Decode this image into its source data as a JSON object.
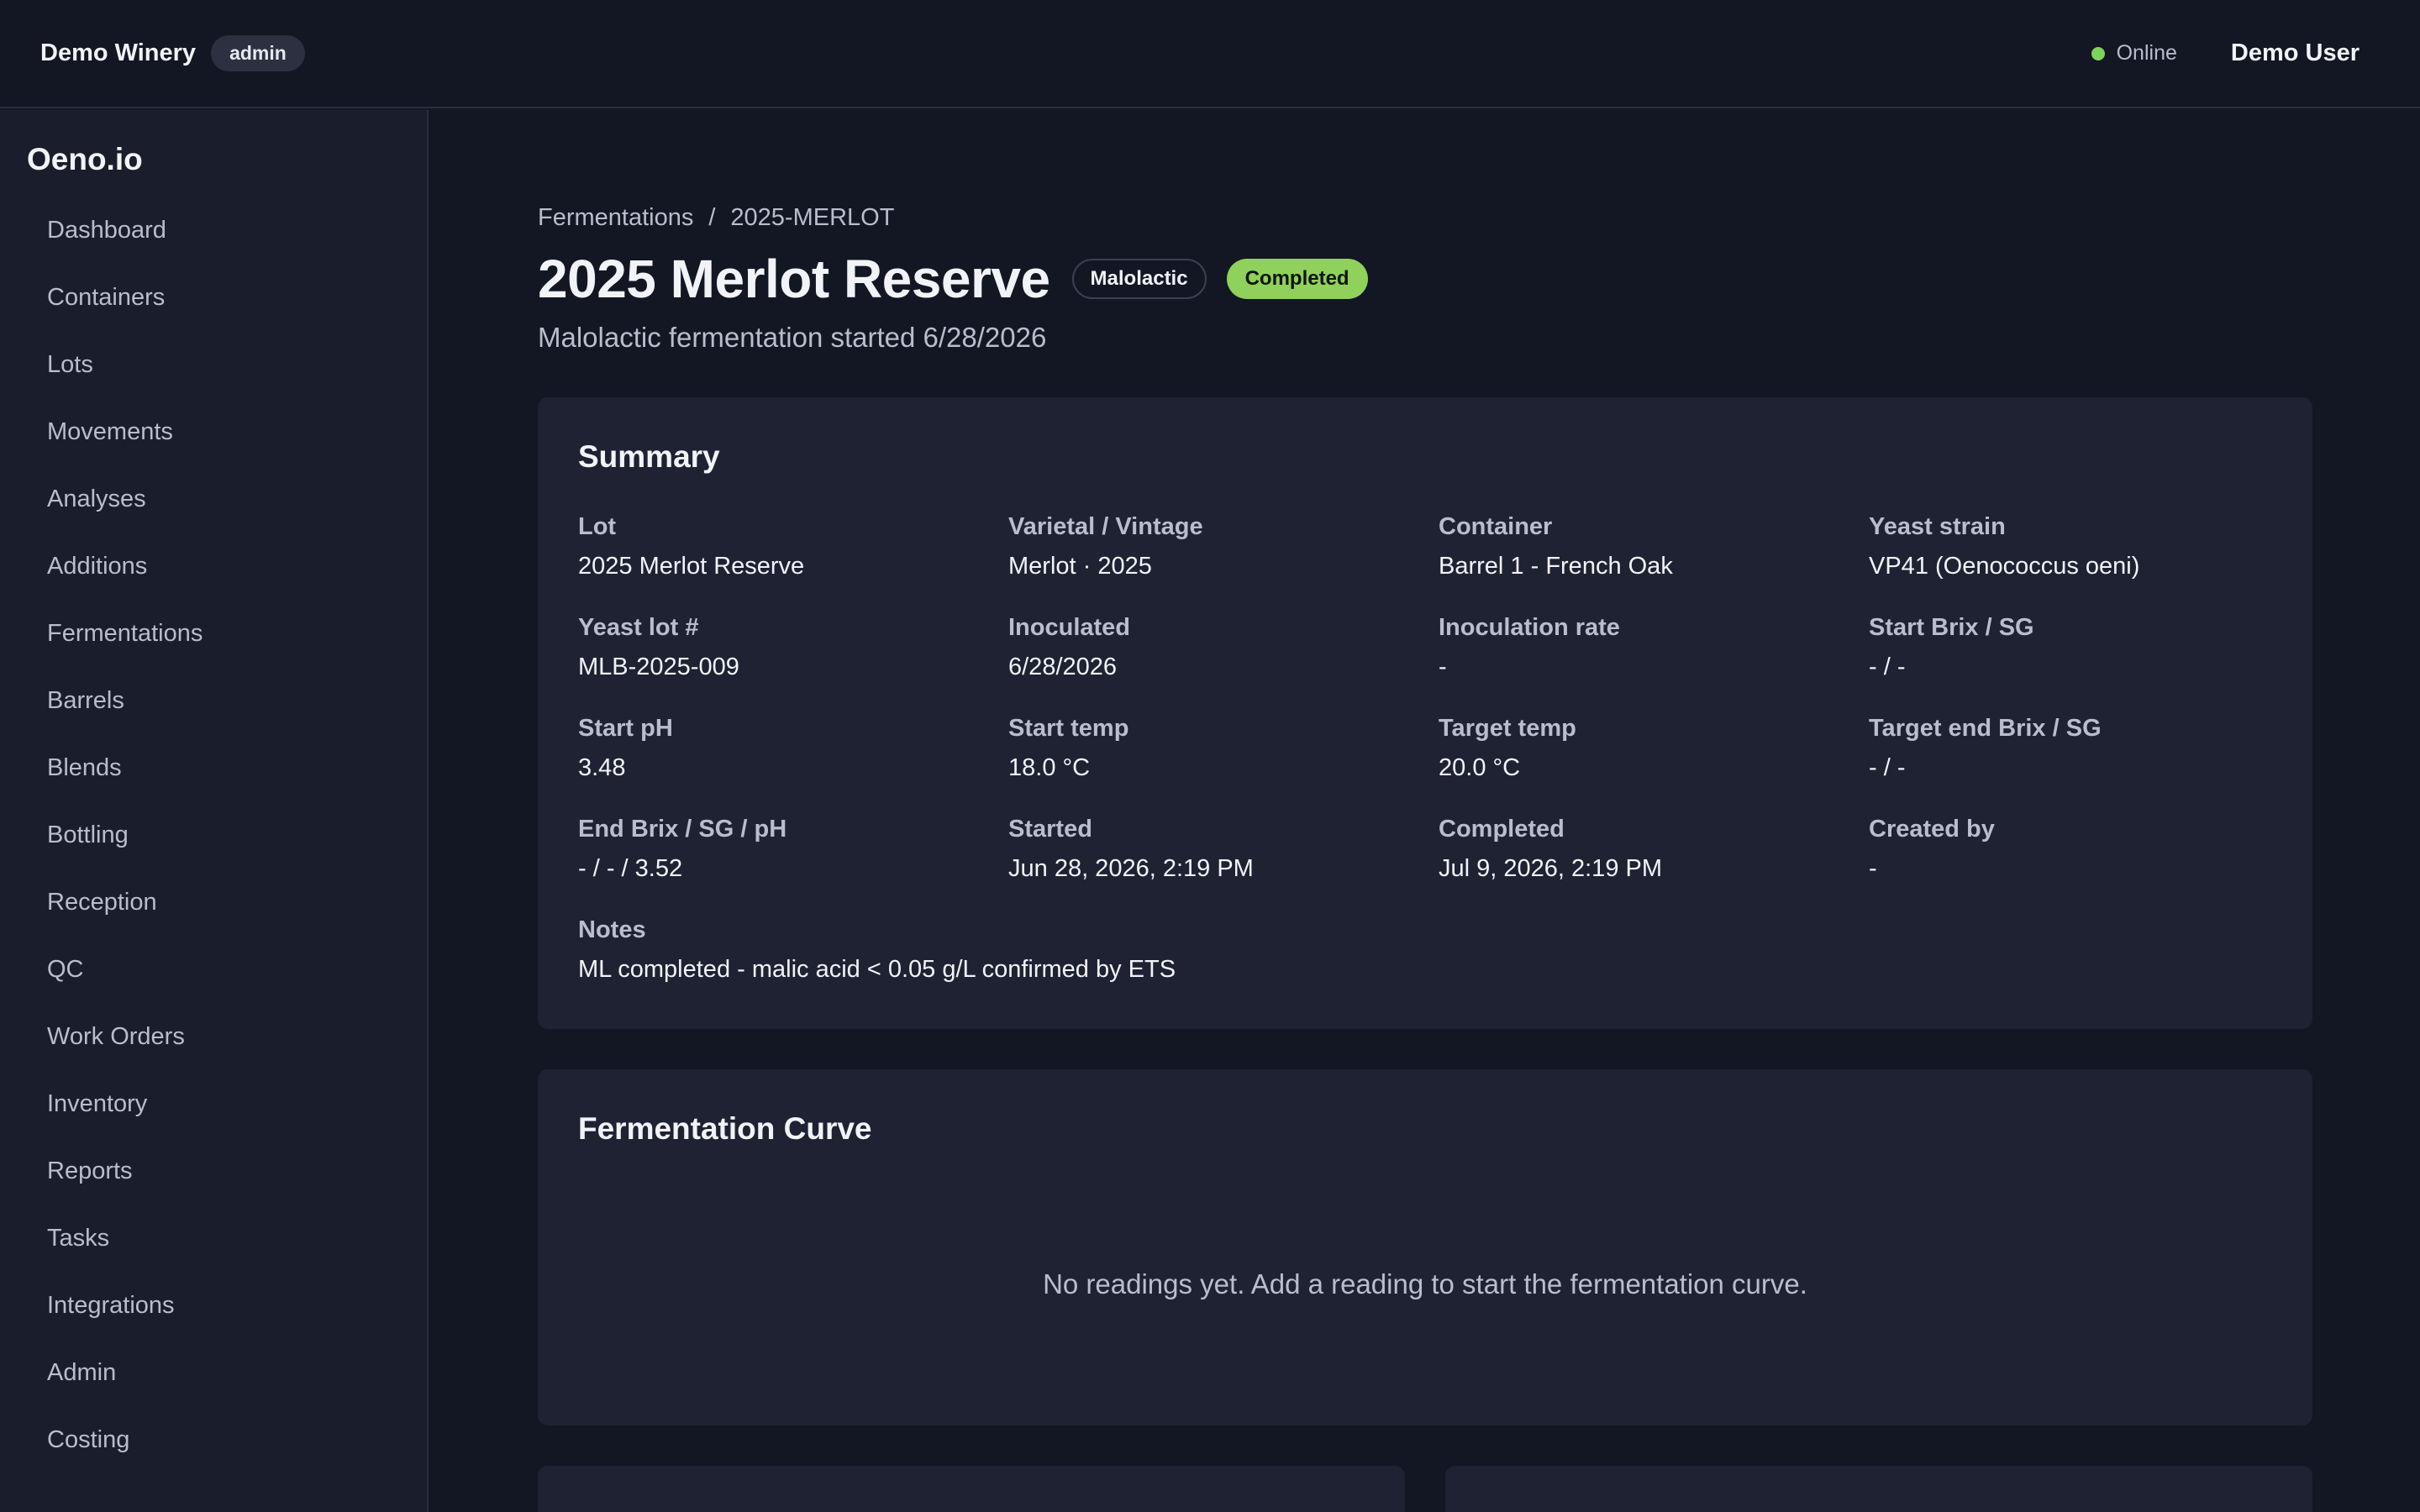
{
  "topbar": {
    "winery_name": "Demo Winery",
    "role": "admin",
    "status": "Online",
    "status_color": "#7ed35a",
    "user_name": "Demo User"
  },
  "sidebar": {
    "brand": "Oeno.io",
    "items": [
      {
        "label": "Dashboard"
      },
      {
        "label": "Containers"
      },
      {
        "label": "Lots"
      },
      {
        "label": "Movements"
      },
      {
        "label": "Analyses"
      },
      {
        "label": "Additions"
      },
      {
        "label": "Fermentations"
      },
      {
        "label": "Barrels"
      },
      {
        "label": "Blends"
      },
      {
        "label": "Bottling"
      },
      {
        "label": "Reception"
      },
      {
        "label": "QC"
      },
      {
        "label": "Work Orders"
      },
      {
        "label": "Inventory"
      },
      {
        "label": "Reports"
      },
      {
        "label": "Tasks"
      },
      {
        "label": "Integrations"
      },
      {
        "label": "Admin"
      },
      {
        "label": "Costing"
      }
    ]
  },
  "breadcrumb": {
    "parent": "Fermentations",
    "separator": "/",
    "current": "2025-MERLOT"
  },
  "header": {
    "title": "2025 Merlot Reserve",
    "type_badge": "Malolactic",
    "status_badge": "Completed",
    "status_color": "#8fd15a",
    "subtitle": "Malolactic fermentation started 6/28/2026"
  },
  "summary": {
    "title": "Summary",
    "fields": [
      {
        "label": "Lot",
        "value": "2025 Merlot Reserve"
      },
      {
        "label": "Varietal / Vintage",
        "value": "Merlot · 2025"
      },
      {
        "label": "Container",
        "value": "Barrel 1 - French Oak"
      },
      {
        "label": "Yeast strain",
        "value": "VP41 (Oenococcus oeni)"
      },
      {
        "label": "Yeast lot #",
        "value": "MLB-2025-009"
      },
      {
        "label": "Inoculated",
        "value": "6/28/2026"
      },
      {
        "label": "Inoculation rate",
        "value": "-"
      },
      {
        "label": "Start Brix / SG",
        "value": "- / -"
      },
      {
        "label": "Start pH",
        "value": "3.48"
      },
      {
        "label": "Start temp",
        "value": "18.0 °C"
      },
      {
        "label": "Target temp",
        "value": "20.0 °C"
      },
      {
        "label": "Target end Brix / SG",
        "value": "- / -"
      },
      {
        "label": "End Brix / SG / pH",
        "value": "- / - / 3.52"
      },
      {
        "label": "Started",
        "value": "Jun 28, 2026, 2:19 PM"
      },
      {
        "label": "Completed",
        "value": "Jul 9, 2026, 2:19 PM"
      },
      {
        "label": "Created by",
        "value": "-"
      },
      {
        "label": "Notes",
        "value": "ML completed - malic acid < 0.05 g/L confirmed by ETS"
      }
    ]
  },
  "curve": {
    "title": "Fermentation Curve",
    "empty_message": "No readings yet. Add a reading to start the fermentation curve."
  }
}
